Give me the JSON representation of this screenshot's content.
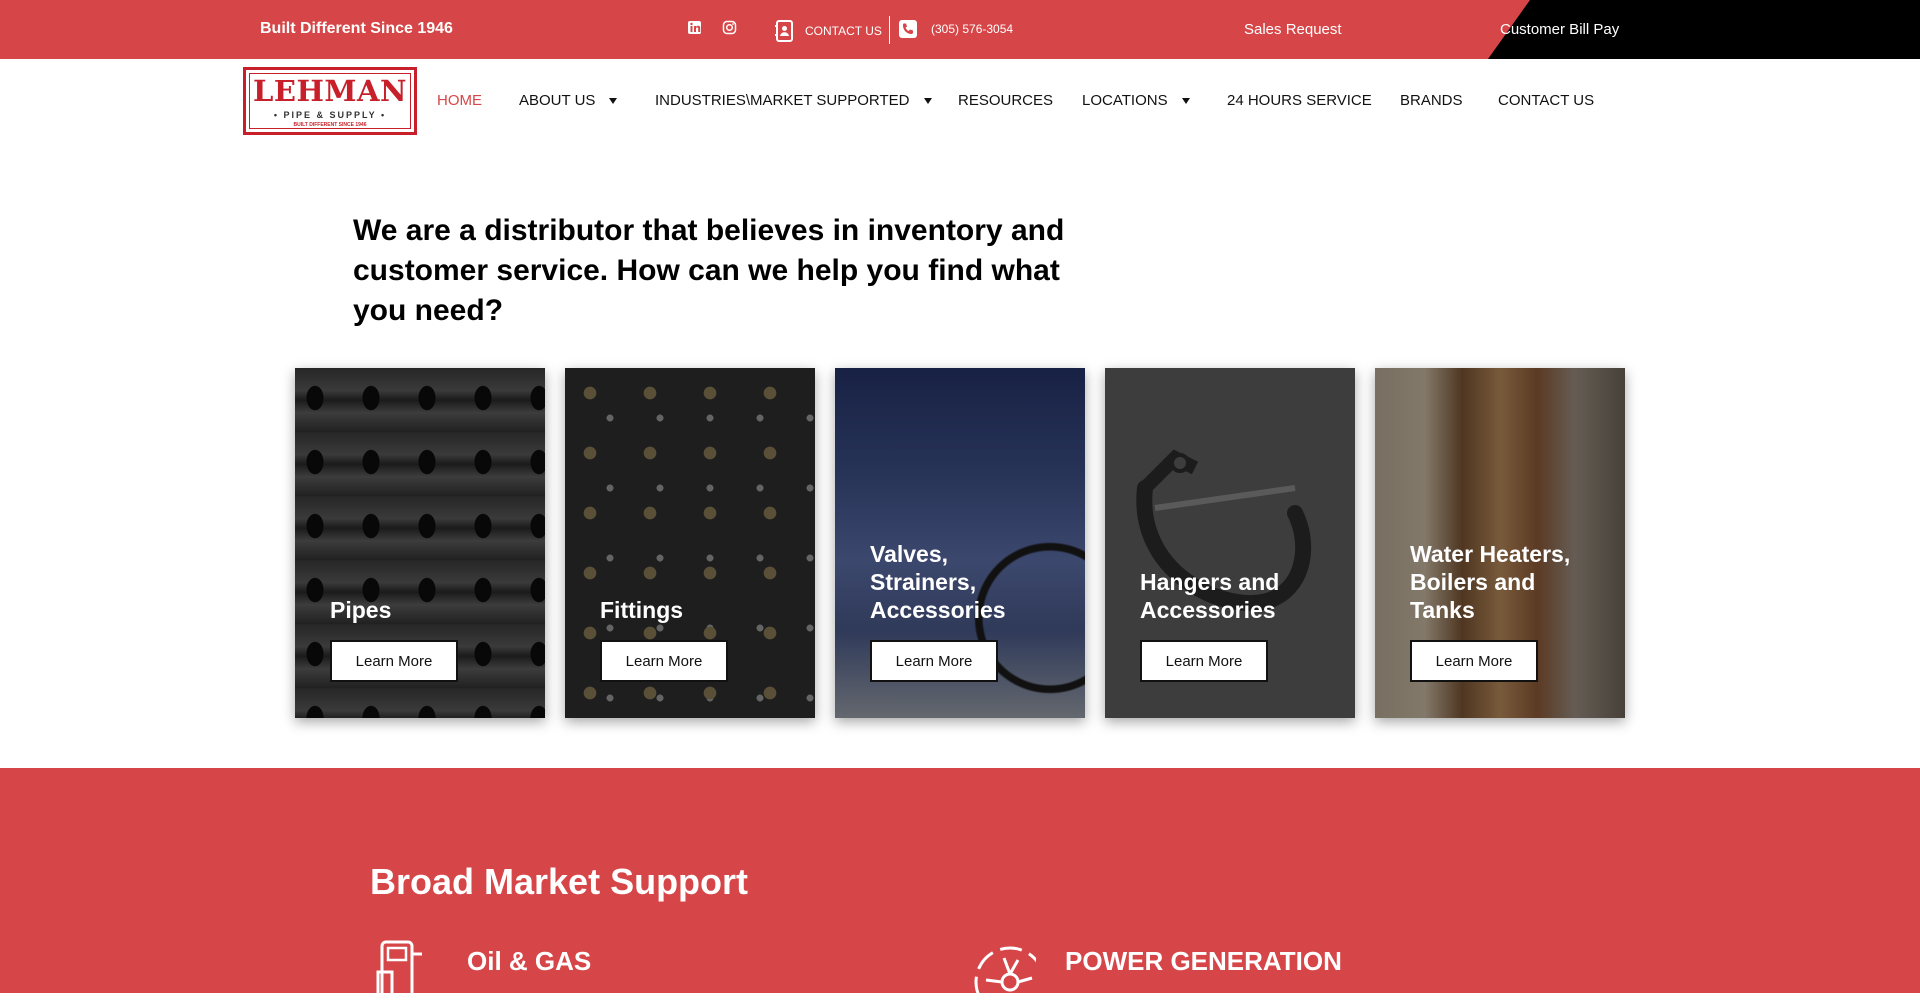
{
  "topbar": {
    "tagline": "Built Different Since 1946",
    "social": [
      "linkedin-icon",
      "instagram-icon"
    ],
    "contact_label": "CONTACT US",
    "phone": "(305) 576-3054",
    "sales_request": "Sales Request",
    "customer_bill_pay": "Customer Bill Pay"
  },
  "logo": {
    "word": "LEHMAN",
    "sub": "• PIPE & SUPPLY •",
    "tag": "BUILT DIFFERENT SINCE 1946"
  },
  "nav": {
    "items": [
      {
        "label": "HOME",
        "active": true
      },
      {
        "label": "ABOUT US",
        "dropdown": true
      },
      {
        "label": "INDUSTRIES\\MARKET SUPPORTED",
        "dropdown": true
      },
      {
        "label": "RESOURCES"
      },
      {
        "label": "LOCATIONS",
        "dropdown": true
      },
      {
        "label": "24 HOURS SERVICE"
      },
      {
        "label": "BRANDS"
      },
      {
        "label": "CONTACT US"
      }
    ]
  },
  "hero": {
    "heading": "We are a distributor that believes in inventory and customer service. How can we help you find what you need?"
  },
  "cards": [
    {
      "title": "Pipes",
      "button": "Learn More"
    },
    {
      "title": "Fittings",
      "button": "Learn More"
    },
    {
      "title": "Valves, Strainers, Accessories",
      "button": "Learn More"
    },
    {
      "title": "Hangers and Accessories",
      "button": "Learn More"
    },
    {
      "title": "Water Heaters, Boilers and Tanks",
      "button": "Learn More"
    }
  ],
  "market": {
    "heading": "Broad Market Support",
    "items": [
      {
        "title": "Oil & GAS",
        "icon": "oil-gas-icon"
      },
      {
        "title": "POWER GENERATION",
        "icon": "power-generation-icon"
      }
    ]
  },
  "colors": {
    "brand_red": "#d64547",
    "black": "#000000"
  }
}
